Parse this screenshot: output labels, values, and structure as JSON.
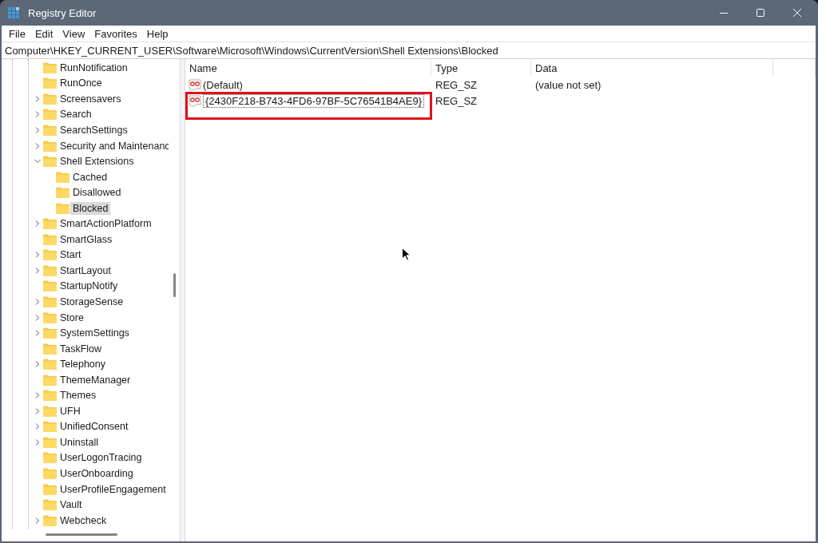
{
  "window": {
    "title": "Registry Editor"
  },
  "menu": [
    "File",
    "Edit",
    "View",
    "Favorites",
    "Help"
  ],
  "address": "Computer\\HKEY_CURRENT_USER\\Software\\Microsoft\\Windows\\CurrentVersion\\Shell Extensions\\Blocked",
  "tree": [
    {
      "label": "RunNotification",
      "expandable": false,
      "selected": false
    },
    {
      "label": "RunOnce",
      "expandable": false,
      "selected": false
    },
    {
      "label": "Screensavers",
      "expandable": true,
      "expanded": false,
      "selected": false
    },
    {
      "label": "Search",
      "expandable": true,
      "expanded": false,
      "selected": false
    },
    {
      "label": "SearchSettings",
      "expandable": true,
      "expanded": false,
      "selected": false
    },
    {
      "label": "Security and Maintenanc",
      "expandable": true,
      "expanded": false,
      "selected": false
    },
    {
      "label": "Shell Extensions",
      "expandable": true,
      "expanded": true,
      "selected": false,
      "children": [
        {
          "label": "Cached",
          "selected": false
        },
        {
          "label": "Disallowed",
          "selected": false
        },
        {
          "label": "Blocked",
          "selected": true
        }
      ]
    },
    {
      "label": "SmartActionPlatform",
      "expandable": true,
      "expanded": false,
      "selected": false
    },
    {
      "label": "SmartGlass",
      "expandable": false,
      "selected": false
    },
    {
      "label": "Start",
      "expandable": true,
      "expanded": false,
      "selected": false
    },
    {
      "label": "StartLayout",
      "expandable": true,
      "expanded": false,
      "selected": false
    },
    {
      "label": "StartupNotify",
      "expandable": false,
      "selected": false
    },
    {
      "label": "StorageSense",
      "expandable": true,
      "expanded": false,
      "selected": false
    },
    {
      "label": "Store",
      "expandable": true,
      "expanded": false,
      "selected": false
    },
    {
      "label": "SystemSettings",
      "expandable": true,
      "expanded": false,
      "selected": false
    },
    {
      "label": "TaskFlow",
      "expandable": false,
      "selected": false
    },
    {
      "label": "Telephony",
      "expandable": true,
      "expanded": false,
      "selected": false
    },
    {
      "label": "ThemeManager",
      "expandable": false,
      "selected": false
    },
    {
      "label": "Themes",
      "expandable": true,
      "expanded": false,
      "selected": false
    },
    {
      "label": "UFH",
      "expandable": true,
      "expanded": false,
      "selected": false
    },
    {
      "label": "UnifiedConsent",
      "expandable": true,
      "expanded": false,
      "selected": false
    },
    {
      "label": "Uninstall",
      "expandable": true,
      "expanded": false,
      "selected": false
    },
    {
      "label": "UserLogonTracing",
      "expandable": false,
      "selected": false
    },
    {
      "label": "UserOnboarding",
      "expandable": false,
      "selected": false
    },
    {
      "label": "UserProfileEngagement",
      "expandable": false,
      "selected": false
    },
    {
      "label": "Vault",
      "expandable": false,
      "selected": false
    },
    {
      "label": "Webcheck",
      "expandable": true,
      "expanded": false,
      "selected": false
    }
  ],
  "table": {
    "columns": [
      "Name",
      "Type",
      "Data"
    ],
    "rows": [
      {
        "name": "(Default)",
        "type": "REG_SZ",
        "data": "(value not set)",
        "editing": false
      },
      {
        "name": "{2430F218-B743-4FD6-97BF-5C76541B4AE9}",
        "type": "REG_SZ",
        "editing": true
      }
    ]
  }
}
